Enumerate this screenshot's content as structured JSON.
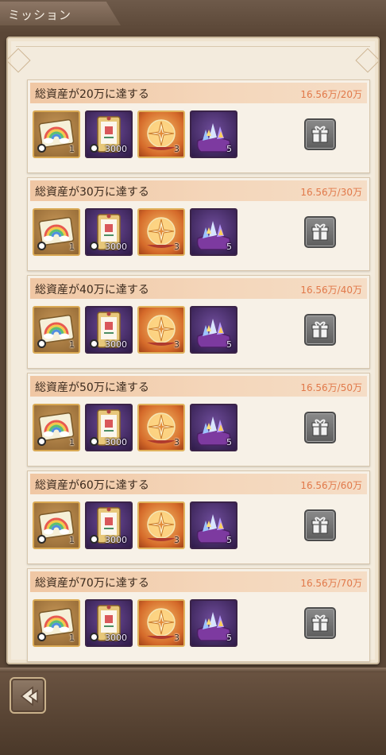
{
  "header": {
    "title": "ミッション"
  },
  "missions": [
    {
      "title": "総資産が20万に達する",
      "progress": "16.56万/20万",
      "rewards": [
        {
          "icon": "rainbow-ticket-icon",
          "qty": "1"
        },
        {
          "icon": "card-ticket-icon",
          "qty": "3000"
        },
        {
          "icon": "compass-orb-icon",
          "qty": "3"
        },
        {
          "icon": "crystal-bag-icon",
          "qty": "5"
        }
      ]
    },
    {
      "title": "総資産が30万に達する",
      "progress": "16.56万/30万",
      "rewards": [
        {
          "icon": "rainbow-ticket-icon",
          "qty": "1"
        },
        {
          "icon": "card-ticket-icon",
          "qty": "3000"
        },
        {
          "icon": "compass-orb-icon",
          "qty": "3"
        },
        {
          "icon": "crystal-bag-icon",
          "qty": "5"
        }
      ]
    },
    {
      "title": "総資産が40万に達する",
      "progress": "16.56万/40万",
      "rewards": [
        {
          "icon": "rainbow-ticket-icon",
          "qty": "1"
        },
        {
          "icon": "card-ticket-icon",
          "qty": "3000"
        },
        {
          "icon": "compass-orb-icon",
          "qty": "3"
        },
        {
          "icon": "crystal-bag-icon",
          "qty": "5"
        }
      ]
    },
    {
      "title": "総資産が50万に達する",
      "progress": "16.56万/50万",
      "rewards": [
        {
          "icon": "rainbow-ticket-icon",
          "qty": "1"
        },
        {
          "icon": "card-ticket-icon",
          "qty": "3000"
        },
        {
          "icon": "compass-orb-icon",
          "qty": "3"
        },
        {
          "icon": "crystal-bag-icon",
          "qty": "5"
        }
      ]
    },
    {
      "title": "総資産が60万に達する",
      "progress": "16.56万/60万",
      "rewards": [
        {
          "icon": "rainbow-ticket-icon",
          "qty": "1"
        },
        {
          "icon": "card-ticket-icon",
          "qty": "3000"
        },
        {
          "icon": "compass-orb-icon",
          "qty": "3"
        },
        {
          "icon": "crystal-bag-icon",
          "qty": "5"
        }
      ]
    },
    {
      "title": "総資産が70万に達する",
      "progress": "16.56万/70万",
      "rewards": [
        {
          "icon": "rainbow-ticket-icon",
          "qty": "1"
        },
        {
          "icon": "card-ticket-icon",
          "qty": "3000"
        },
        {
          "icon": "compass-orb-icon",
          "qty": "3"
        },
        {
          "icon": "crystal-bag-icon",
          "qty": "5"
        }
      ]
    }
  ],
  "claim_icon": "gift-icon",
  "back_icon": "back-arrow-icon",
  "colors": {
    "progress_text": "#e1794a",
    "header_gradient_start": "#f0c7a4",
    "panel_bg": "#f3ebdd",
    "frame_brown": "#5a4636"
  }
}
